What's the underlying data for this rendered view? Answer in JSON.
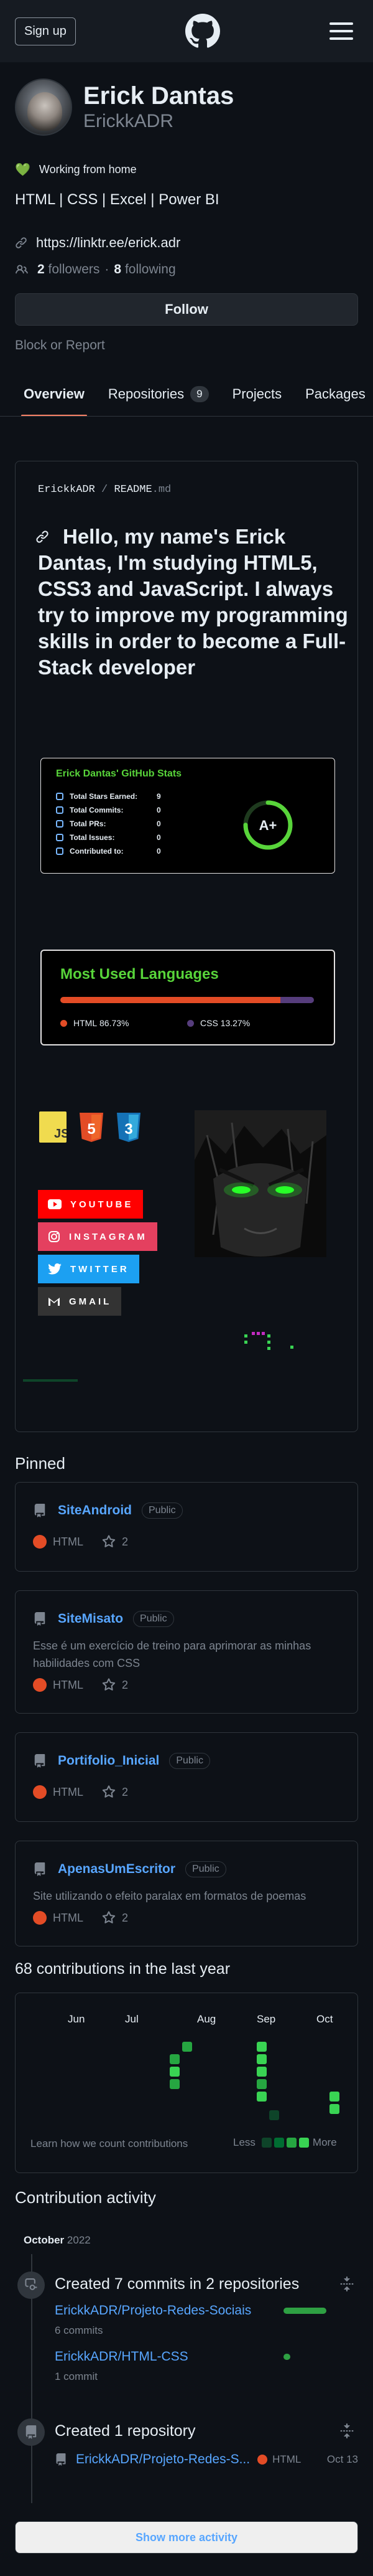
{
  "header": {
    "signup_label": "Sign up",
    "logo_icon": "github-logo-icon",
    "menu_icon": "hamburger-menu-icon"
  },
  "profile": {
    "full_name": "Erick Dantas",
    "username": "ErickkADR",
    "status_emoji": "💚",
    "status": "Working from home",
    "bio": "HTML | CSS | Excel | Power BI",
    "website": "https://linktr.ee/erick.adr",
    "followers_count": "2",
    "followers_label": "followers",
    "separator": "·",
    "following_count": "8",
    "following_label": "following",
    "follow_button": "Follow",
    "block_report": "Block or Report"
  },
  "tabs": [
    {
      "label": "Overview"
    },
    {
      "label": "Repositories",
      "count": "9"
    },
    {
      "label": "Projects"
    },
    {
      "label": "Packages"
    }
  ],
  "readme": {
    "path_user": "ErickkADR",
    "path_sep": "/",
    "path_file": "README",
    "path_ext": ".md",
    "title": "Hello, my name's Erick Dantas, I'm studying HTML5, CSS3 and JavaScript. I always try to improve my programming skills in order to become a Full-Stack developer",
    "stats_card": {
      "title": "Erick Dantas' GitHub Stats",
      "rows": [
        {
          "label": "Total Stars Earned:",
          "value": "9"
        },
        {
          "label": "Total Commits:",
          "value": "0"
        },
        {
          "label": "Total PRs:",
          "value": "0"
        },
        {
          "label": "Total Issues:",
          "value": "0"
        },
        {
          "label": "Contributed to:",
          "value": "0"
        }
      ],
      "grade": "A+",
      "grade_progress": 0.75
    },
    "languages_card": {
      "title": "Most Used Languages",
      "languages": [
        {
          "name": "HTML",
          "percent": "86.73%",
          "value": 86.73,
          "color": "#e34c26"
        },
        {
          "name": "CSS",
          "percent": "13.27%",
          "value": 13.27,
          "color": "#563d7c"
        }
      ]
    },
    "tech_icons": [
      "js-icon",
      "html5-icon",
      "css3-icon"
    ],
    "tech_labels": {
      "js": "JS",
      "html": "5",
      "css": "3"
    },
    "social_badges": [
      {
        "label": "YOUTUBE",
        "icon": "youtube-icon",
        "color": "#ff0000"
      },
      {
        "label": "INSTAGRAM",
        "icon": "instagram-icon",
        "color": "#e4405f"
      },
      {
        "label": "TWITTER",
        "icon": "twitter-icon",
        "color": "#1ca0f2"
      },
      {
        "label": "GMAIL",
        "icon": "gmail-icon",
        "color": "#333333"
      }
    ]
  },
  "pinned": {
    "title": "Pinned",
    "items": [
      {
        "name": "SiteAndroid",
        "visibility": "Public",
        "description": "",
        "language": "HTML",
        "stars": "2"
      },
      {
        "name": "SiteMisato",
        "visibility": "Public",
        "description": "Esse é um exercício de treino para aprimorar as minhas habilidades com CSS",
        "language": "HTML",
        "stars": "2"
      },
      {
        "name": "Portifolio_Inicial",
        "visibility": "Public",
        "description": "",
        "language": "HTML",
        "stars": "2"
      },
      {
        "name": "ApenasUmEscritor",
        "visibility": "Public",
        "description": "Site utilizando o efeito paralax em formatos de poemas",
        "language": "HTML",
        "stars": "2"
      }
    ]
  },
  "contributions": {
    "title": "68 contributions in the last year",
    "months": [
      "Jun",
      "Jul",
      "Aug",
      "Sep",
      "Oct"
    ],
    "learn_label": "Learn how we count contributions",
    "less_label": "Less",
    "more_label": "More",
    "colors": [
      "#161b22",
      "#0e4429",
      "#006d32",
      "#26a641",
      "#39d353"
    ]
  },
  "activity": {
    "title": "Contribution activity",
    "month": "October",
    "year": "2022",
    "event1": {
      "title": "Created 7 commits in 2 repositories",
      "repos": [
        {
          "name": "ErickkADR/Projeto-Redes-Sociais",
          "commits": "6 commits",
          "fraction": 0.857
        },
        {
          "name": "ErickkADR/HTML-CSS",
          "commits": "1 commit",
          "fraction": 0.143
        }
      ]
    },
    "event2": {
      "title": "Created 1 repository",
      "repo": "ErickkADR/Projeto-Redes-S...",
      "language": "HTML",
      "date": "Oct 13"
    },
    "show_more": "Show more activity"
  }
}
